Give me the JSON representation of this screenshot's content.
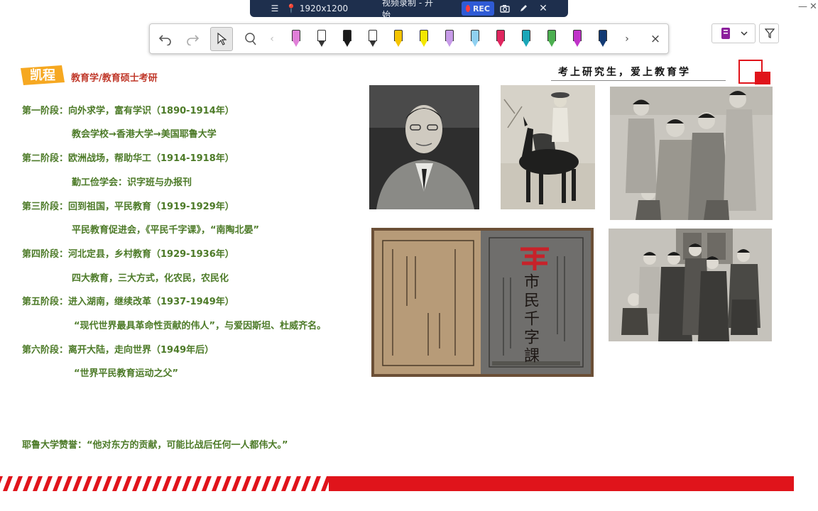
{
  "recorder": {
    "menu_icon": "hamburger-icon",
    "pin_icon": "pin-icon",
    "resolution": "1920x1200",
    "status": "视频录制 - 开始",
    "rec_label": "REC",
    "camera_icon": "camera-icon",
    "pen_icon": "pen-icon",
    "close_icon": "close-icon"
  },
  "pen_toolbar": {
    "tools": [
      "undo-icon",
      "redo-icon",
      "cursor-icon",
      "lasso-icon",
      "chevron-left-icon"
    ],
    "pen_colors": [
      "#e07fd8",
      "#ffffff",
      "#1a1a1a",
      "#ffffff",
      "#f5c400",
      "#f3e600",
      "#c79be8",
      "#8fd0f0",
      "#e0265f",
      "#1aa7b8",
      "#4caf50",
      "#c033c9",
      "#123a73"
    ],
    "next_icon": "chevron-right-icon",
    "close_label": "×"
  },
  "slide": {
    "logo_text": "凯程",
    "course_title": "教育学/教育硕士考研",
    "slogan": "考上研究生，爱上教育学",
    "stages": [
      {
        "label": "第一阶段：向外求学，富有学识（1890-1914年）",
        "detail": "教会学校→香港大学→美国耶鲁大学"
      },
      {
        "label": "第二阶段：欧洲战场，帮助华工（1914-1918年）",
        "detail": "勤工俭学会：识字班与办报刊"
      },
      {
        "label": "第三阶段：回到祖国，平民教育（1919-1929年）",
        "detail": "平民教育促进会，《平民千字课》，“南陶北晏”"
      },
      {
        "label": "第四阶段：河北定县，乡村教育（1929-1936年）",
        "detail": "四大教育，三大方式，化农民，农民化"
      },
      {
        "label": "第五阶段：进入湖南，继续改革（1937-1949年）",
        "detail": "“现代世界最具革命性贡献的伟人”，与爱因斯坦、杜威齐名。"
      },
      {
        "label": "第六阶段：离开大陆，走向世界（1949年后）",
        "detail": "“世界平民教育运动之父”"
      }
    ],
    "quote": "耶鲁大学赞誉：“他对东方的贡献，可能比战后任何一人都伟大。”",
    "book_title": "市民千字課",
    "accent_red": "#e0141b",
    "text_green": "#4c7a27"
  }
}
